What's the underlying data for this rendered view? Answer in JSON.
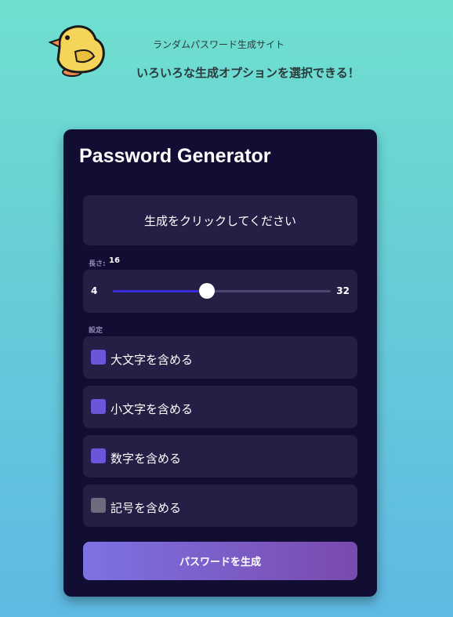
{
  "header": {
    "site_title": "ランダムパスワード生成サイト",
    "site_subtitle": "いろいろな生成オプションを選択できる！",
    "logo_icon": "chick-icon"
  },
  "card": {
    "title": "Password Generator",
    "result_text": "生成をクリックしてください",
    "length": {
      "label": "長さ:",
      "value": "16",
      "min": "4",
      "max": "32",
      "level": 0.43
    },
    "settings_label": "設定",
    "options": [
      {
        "label": "大文字を含める",
        "checked": true
      },
      {
        "label": "小文字を含める",
        "checked": true
      },
      {
        "label": "数字を含める",
        "checked": true
      },
      {
        "label": "記号を含める",
        "checked": false
      }
    ],
    "generate_label": "パスワードを生成"
  },
  "colors": {
    "card_bg": "#120e33",
    "panel_bg": "#241f45",
    "accent": "#6b55d8",
    "slider_fill": "#3a2bd8",
    "button_gradient_start": "#7d72e3",
    "button_gradient_end": "#7a4aad"
  }
}
